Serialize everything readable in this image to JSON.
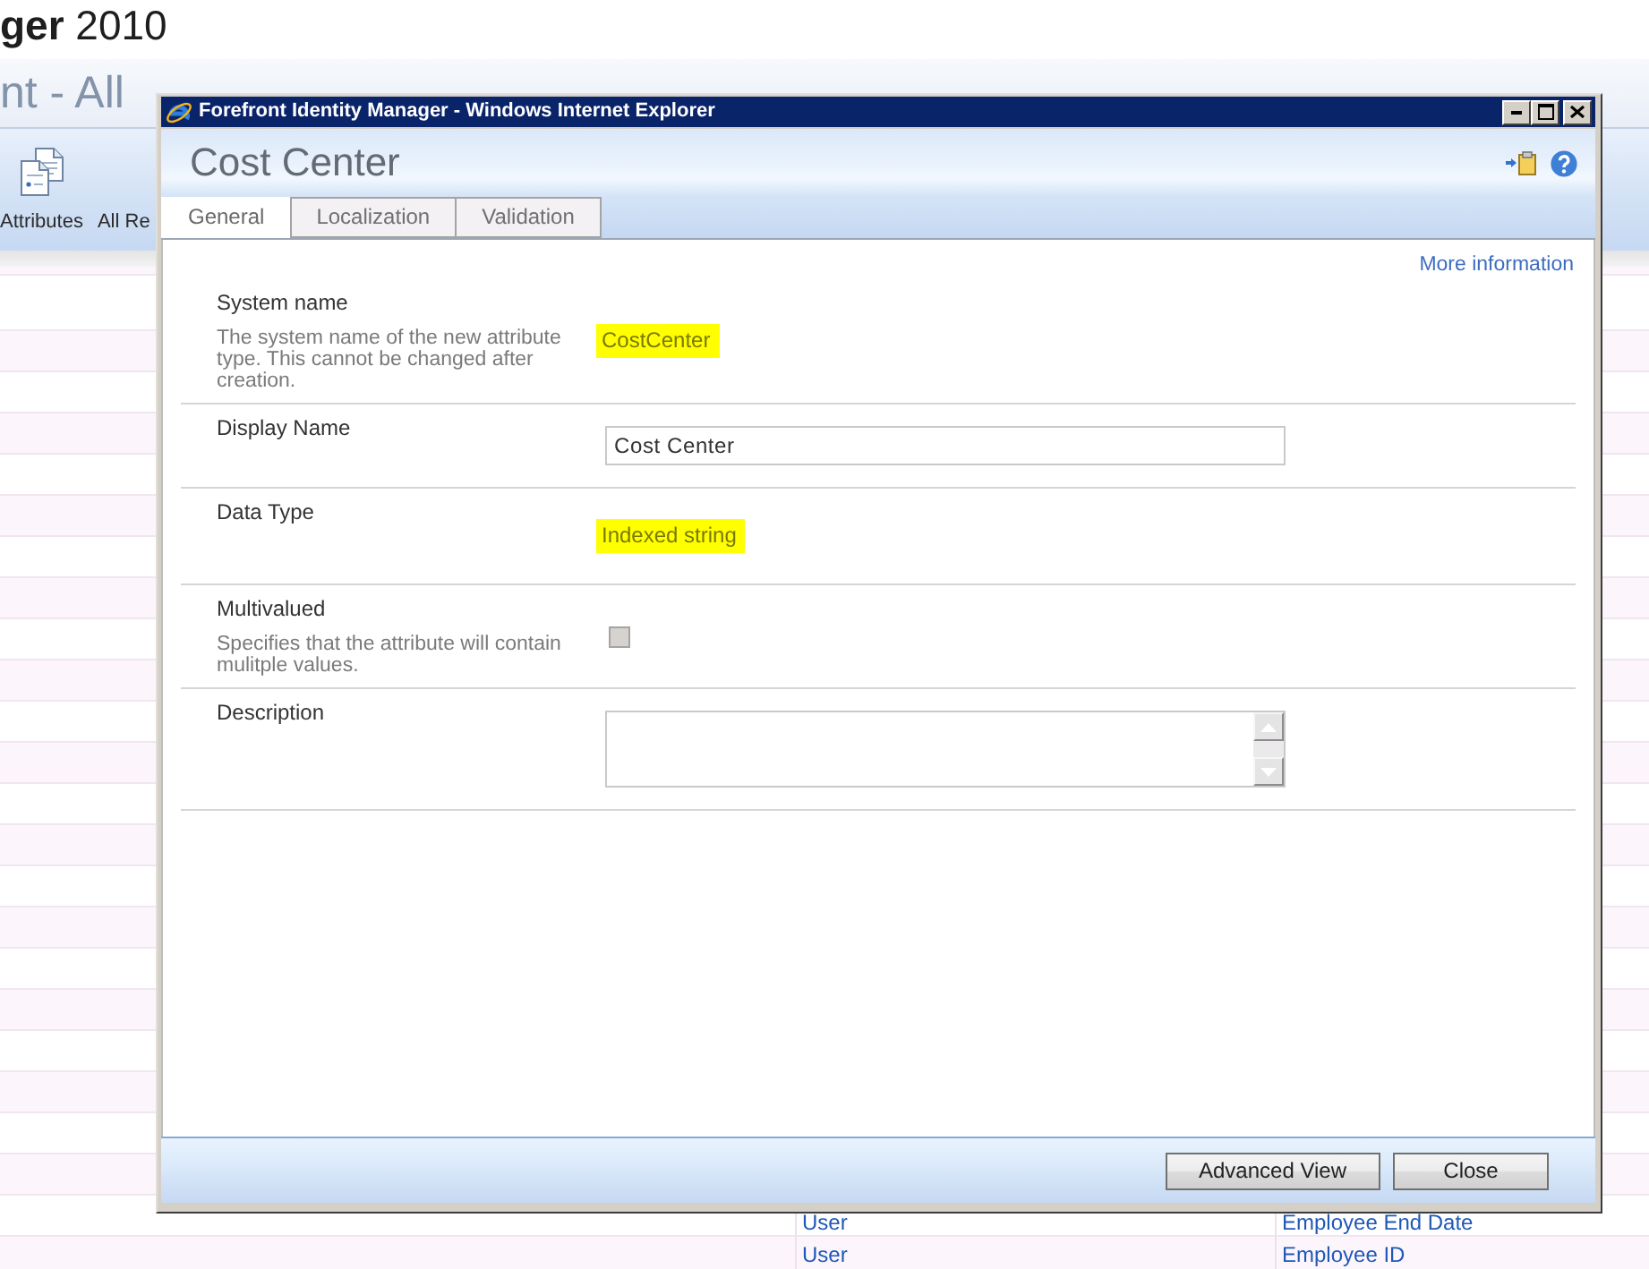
{
  "portal": {
    "product_title": "**ger** 2010",
    "page_title": "nt - All",
    "toolbar": [
      {
        "kind": "icon",
        "label": "Attributes"
      },
      {
        "kind": "text",
        "label": "All Re"
      }
    ],
    "list": {
      "rows": [
        {
          "column_1": "User",
          "column_2": "Employee End Date"
        },
        {
          "column_1": "User",
          "column_2": "Employee ID"
        }
      ]
    }
  },
  "dialog": {
    "window_title": "Forefront Identity Manager - Windows Internet Explorer",
    "title": "Cost Center",
    "tabs": [
      {
        "label": "General",
        "selected": true
      },
      {
        "label": "Localization",
        "selected": false
      },
      {
        "label": "Validation",
        "selected": false
      }
    ],
    "more_information": "More information",
    "fields": [
      {
        "kind": "readonly",
        "label": "System name",
        "description": "The system name of the new attribute type. This cannot be changed after creation.",
        "value": "CostCenter",
        "highlighted": true
      },
      {
        "kind": "text",
        "label": "Display Name",
        "value": "Cost Center"
      },
      {
        "kind": "readonly",
        "label": "Data Type",
        "value": "Indexed string",
        "highlighted": true
      },
      {
        "kind": "checkbox",
        "label": "Multivalued",
        "description": "Specifies that the attribute will contain mulitple values.",
        "checked": false,
        "disabled": true
      },
      {
        "kind": "textarea",
        "label": "Description"
      }
    ],
    "buttons": [
      "Advanced View",
      "Close"
    ]
  }
}
